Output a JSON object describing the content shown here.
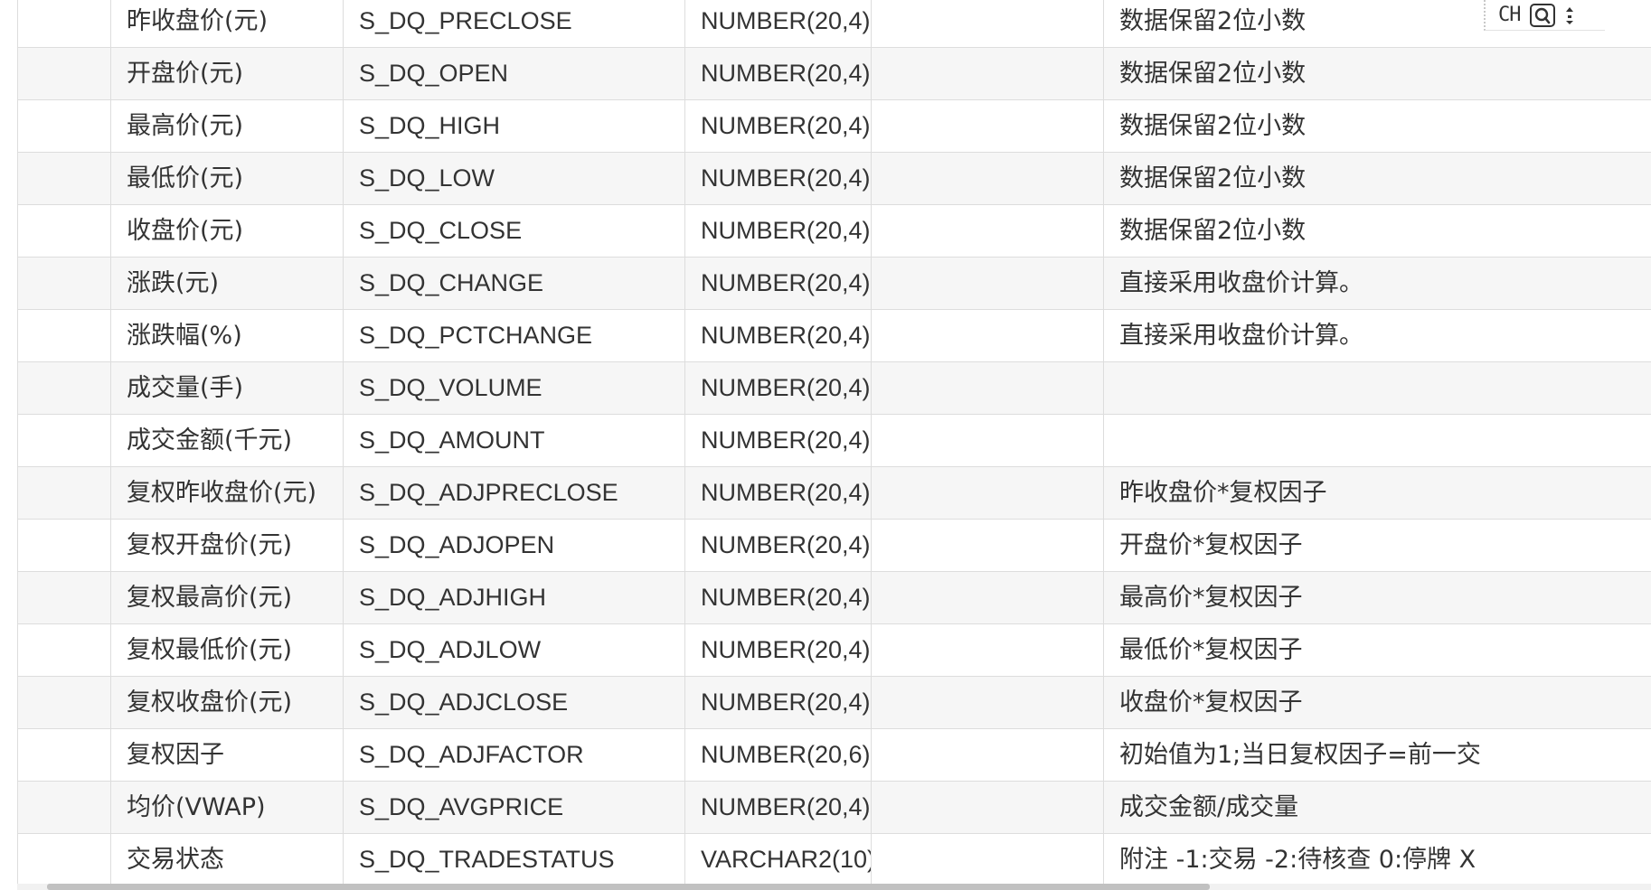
{
  "table": {
    "rows": [
      {
        "col0": "",
        "cn_name": "昨收盘价(元)",
        "field": "S_DQ_PRECLOSE",
        "type": "NUMBER(20,4)",
        "col4": "",
        "remark": "数据保留2位小数"
      },
      {
        "col0": "",
        "cn_name": "开盘价(元)",
        "field": "S_DQ_OPEN",
        "type": "NUMBER(20,4)",
        "col4": "",
        "remark": "数据保留2位小数"
      },
      {
        "col0": "",
        "cn_name": "最高价(元)",
        "field": "S_DQ_HIGH",
        "type": "NUMBER(20,4)",
        "col4": "",
        "remark": "数据保留2位小数"
      },
      {
        "col0": "",
        "cn_name": "最低价(元)",
        "field": "S_DQ_LOW",
        "type": "NUMBER(20,4)",
        "col4": "",
        "remark": "数据保留2位小数"
      },
      {
        "col0": "",
        "cn_name": "收盘价(元)",
        "field": "S_DQ_CLOSE",
        "type": "NUMBER(20,4)",
        "col4": "",
        "remark": "数据保留2位小数"
      },
      {
        "col0": "",
        "cn_name": "涨跌(元)",
        "field": "S_DQ_CHANGE",
        "type": "NUMBER(20,4)",
        "col4": "",
        "remark": "直接采用收盘价计算。"
      },
      {
        "col0": "",
        "cn_name": "涨跌幅(%)",
        "field": "S_DQ_PCTCHANGE",
        "type": "NUMBER(20,4)",
        "col4": "",
        "remark": "直接采用收盘价计算。"
      },
      {
        "col0": "",
        "cn_name": "成交量(手)",
        "field": "S_DQ_VOLUME",
        "type": "NUMBER(20,4)",
        "col4": "",
        "remark": ""
      },
      {
        "col0": "",
        "cn_name": "成交金额(千元)",
        "field": "S_DQ_AMOUNT",
        "type": "NUMBER(20,4)",
        "col4": "",
        "remark": ""
      },
      {
        "col0": "",
        "cn_name": "复权昨收盘价(元)",
        "field": "S_DQ_ADJPRECLOSE",
        "type": "NUMBER(20,4)",
        "col4": "",
        "remark": "昨收盘价*复权因子"
      },
      {
        "col0": "",
        "cn_name": "复权开盘价(元)",
        "field": "S_DQ_ADJOPEN",
        "type": "NUMBER(20,4)",
        "col4": "",
        "remark": "开盘价*复权因子"
      },
      {
        "col0": "",
        "cn_name": "复权最高价(元)",
        "field": "S_DQ_ADJHIGH",
        "type": "NUMBER(20,4)",
        "col4": "",
        "remark": "最高价*复权因子"
      },
      {
        "col0": "",
        "cn_name": "复权最低价(元)",
        "field": "S_DQ_ADJLOW",
        "type": "NUMBER(20,4)",
        "col4": "",
        "remark": "最低价*复权因子"
      },
      {
        "col0": "",
        "cn_name": "复权收盘价(元)",
        "field": "S_DQ_ADJCLOSE",
        "type": "NUMBER(20,4)",
        "col4": "",
        "remark": "收盘价*复权因子"
      },
      {
        "col0": "",
        "cn_name": "复权因子",
        "field": "S_DQ_ADJFACTOR",
        "type": "NUMBER(20,6)",
        "col4": "",
        "remark": "初始值为1;当日复权因子=前一交"
      },
      {
        "col0": "",
        "cn_name": "均价(VWAP)",
        "field": "S_DQ_AVGPRICE",
        "type": "NUMBER(20,4)",
        "col4": "",
        "remark": "成交金额/成交量"
      },
      {
        "col0": "",
        "cn_name": "交易状态",
        "field": "S_DQ_TRADESTATUS",
        "type": "VARCHAR2(10)",
        "col4": "",
        "remark": "附注 -1:交易 -2:待核查 0:停牌 X"
      }
    ]
  },
  "float_toolbar": {
    "lang_label": "CH",
    "icons": [
      "search-icon",
      "more-vertical-icon"
    ]
  },
  "colors": {
    "row_even": "#f6f6f6",
    "row_odd": "#ffffff",
    "border": "#dddddd",
    "text": "#333333",
    "scrollbar_thumb": "#c1c1c1"
  },
  "scroll": {
    "horizontal_visible_fraction": 0.71
  }
}
